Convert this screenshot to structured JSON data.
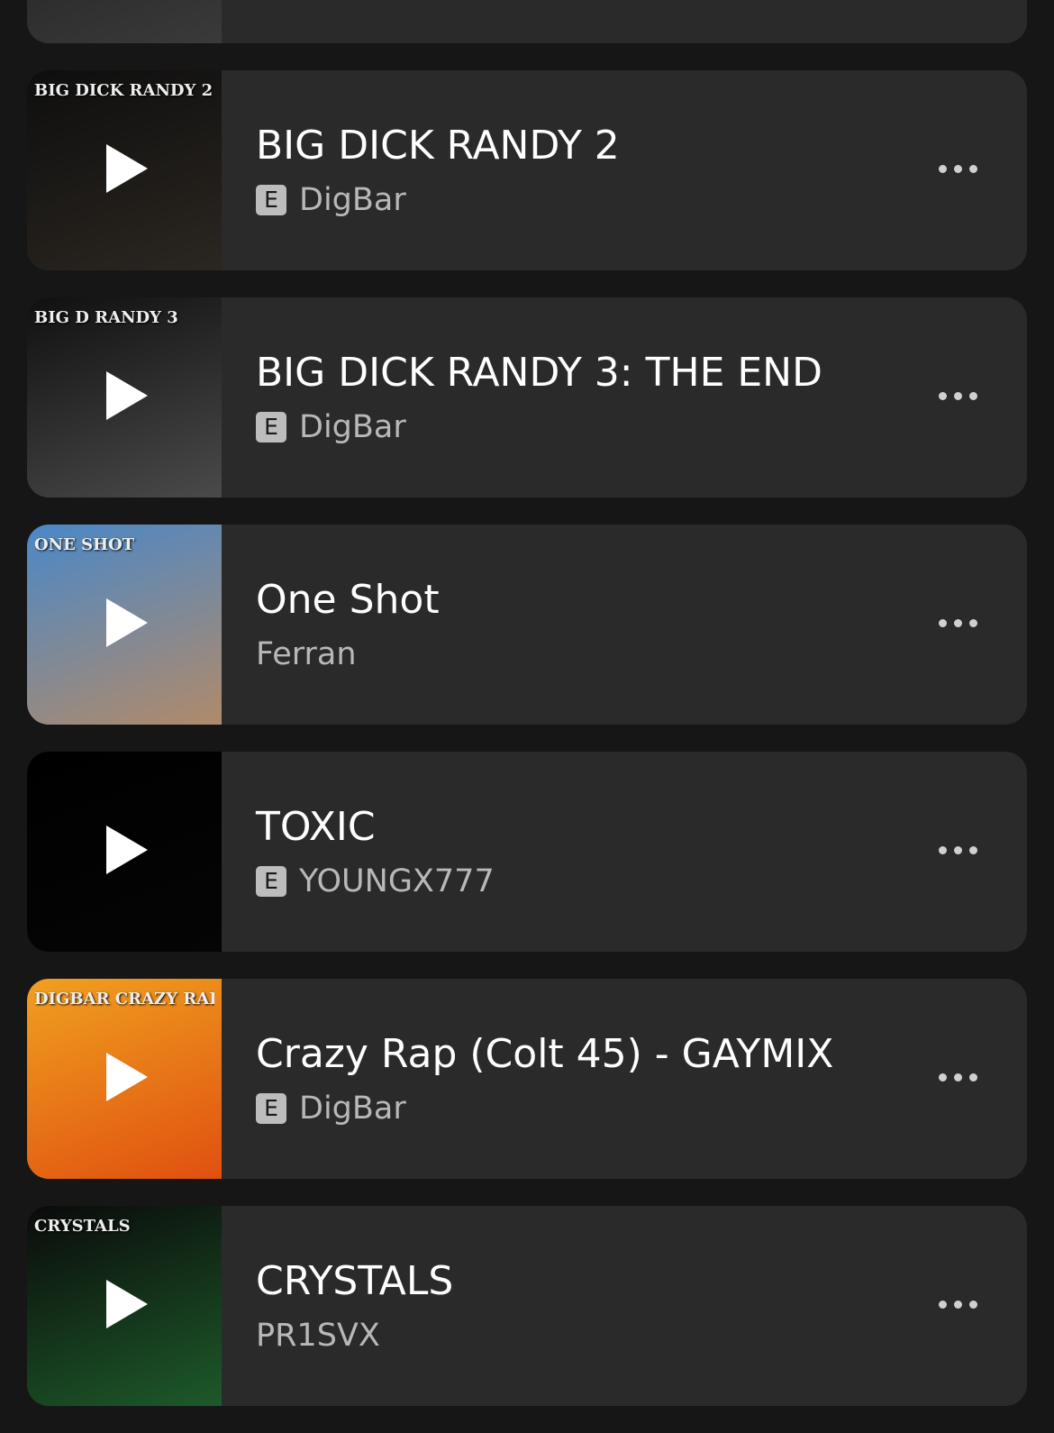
{
  "tracks": [
    {
      "title": "",
      "artist": "",
      "explicit": false,
      "art_label": "",
      "art_colors": [
        "#1c1c1c",
        "#3a3a3a"
      ]
    },
    {
      "title": "BIG DICK RANDY 2",
      "artist": "DigBar",
      "explicit": true,
      "art_label": "BIG DICK RANDY 2",
      "art_colors": [
        "#0e0e0e",
        "#2b2620"
      ]
    },
    {
      "title": "BIG DICK RANDY 3: THE END",
      "artist": "DigBar",
      "explicit": true,
      "art_label": "BIG D RANDY 3",
      "art_colors": [
        "#101010",
        "#4a4a4a"
      ]
    },
    {
      "title": "One Shot",
      "artist": "Ferran",
      "explicit": false,
      "art_label": "ONE SHOT",
      "art_colors": [
        "#4a88c8",
        "#b08a6a"
      ]
    },
    {
      "title": "TOXIC",
      "artist": "YOUNGX777",
      "explicit": true,
      "art_label": "",
      "art_colors": [
        "#000000",
        "#050505"
      ]
    },
    {
      "title": "Crazy Rap (Colt 45) - GAYMIX",
      "artist": "DigBar",
      "explicit": true,
      "art_label": "DIGBAR CRAZY RAP",
      "art_colors": [
        "#f0a020",
        "#e05010"
      ]
    },
    {
      "title": "CRYSTALS",
      "artist": "PR1SVX",
      "explicit": false,
      "art_label": "CRYSTALS",
      "art_colors": [
        "#0a0a0a",
        "#1d5a2a"
      ]
    }
  ],
  "explicit_badge": "E",
  "icons": {
    "play": "play-icon",
    "more": "more-horizontal-icon"
  }
}
